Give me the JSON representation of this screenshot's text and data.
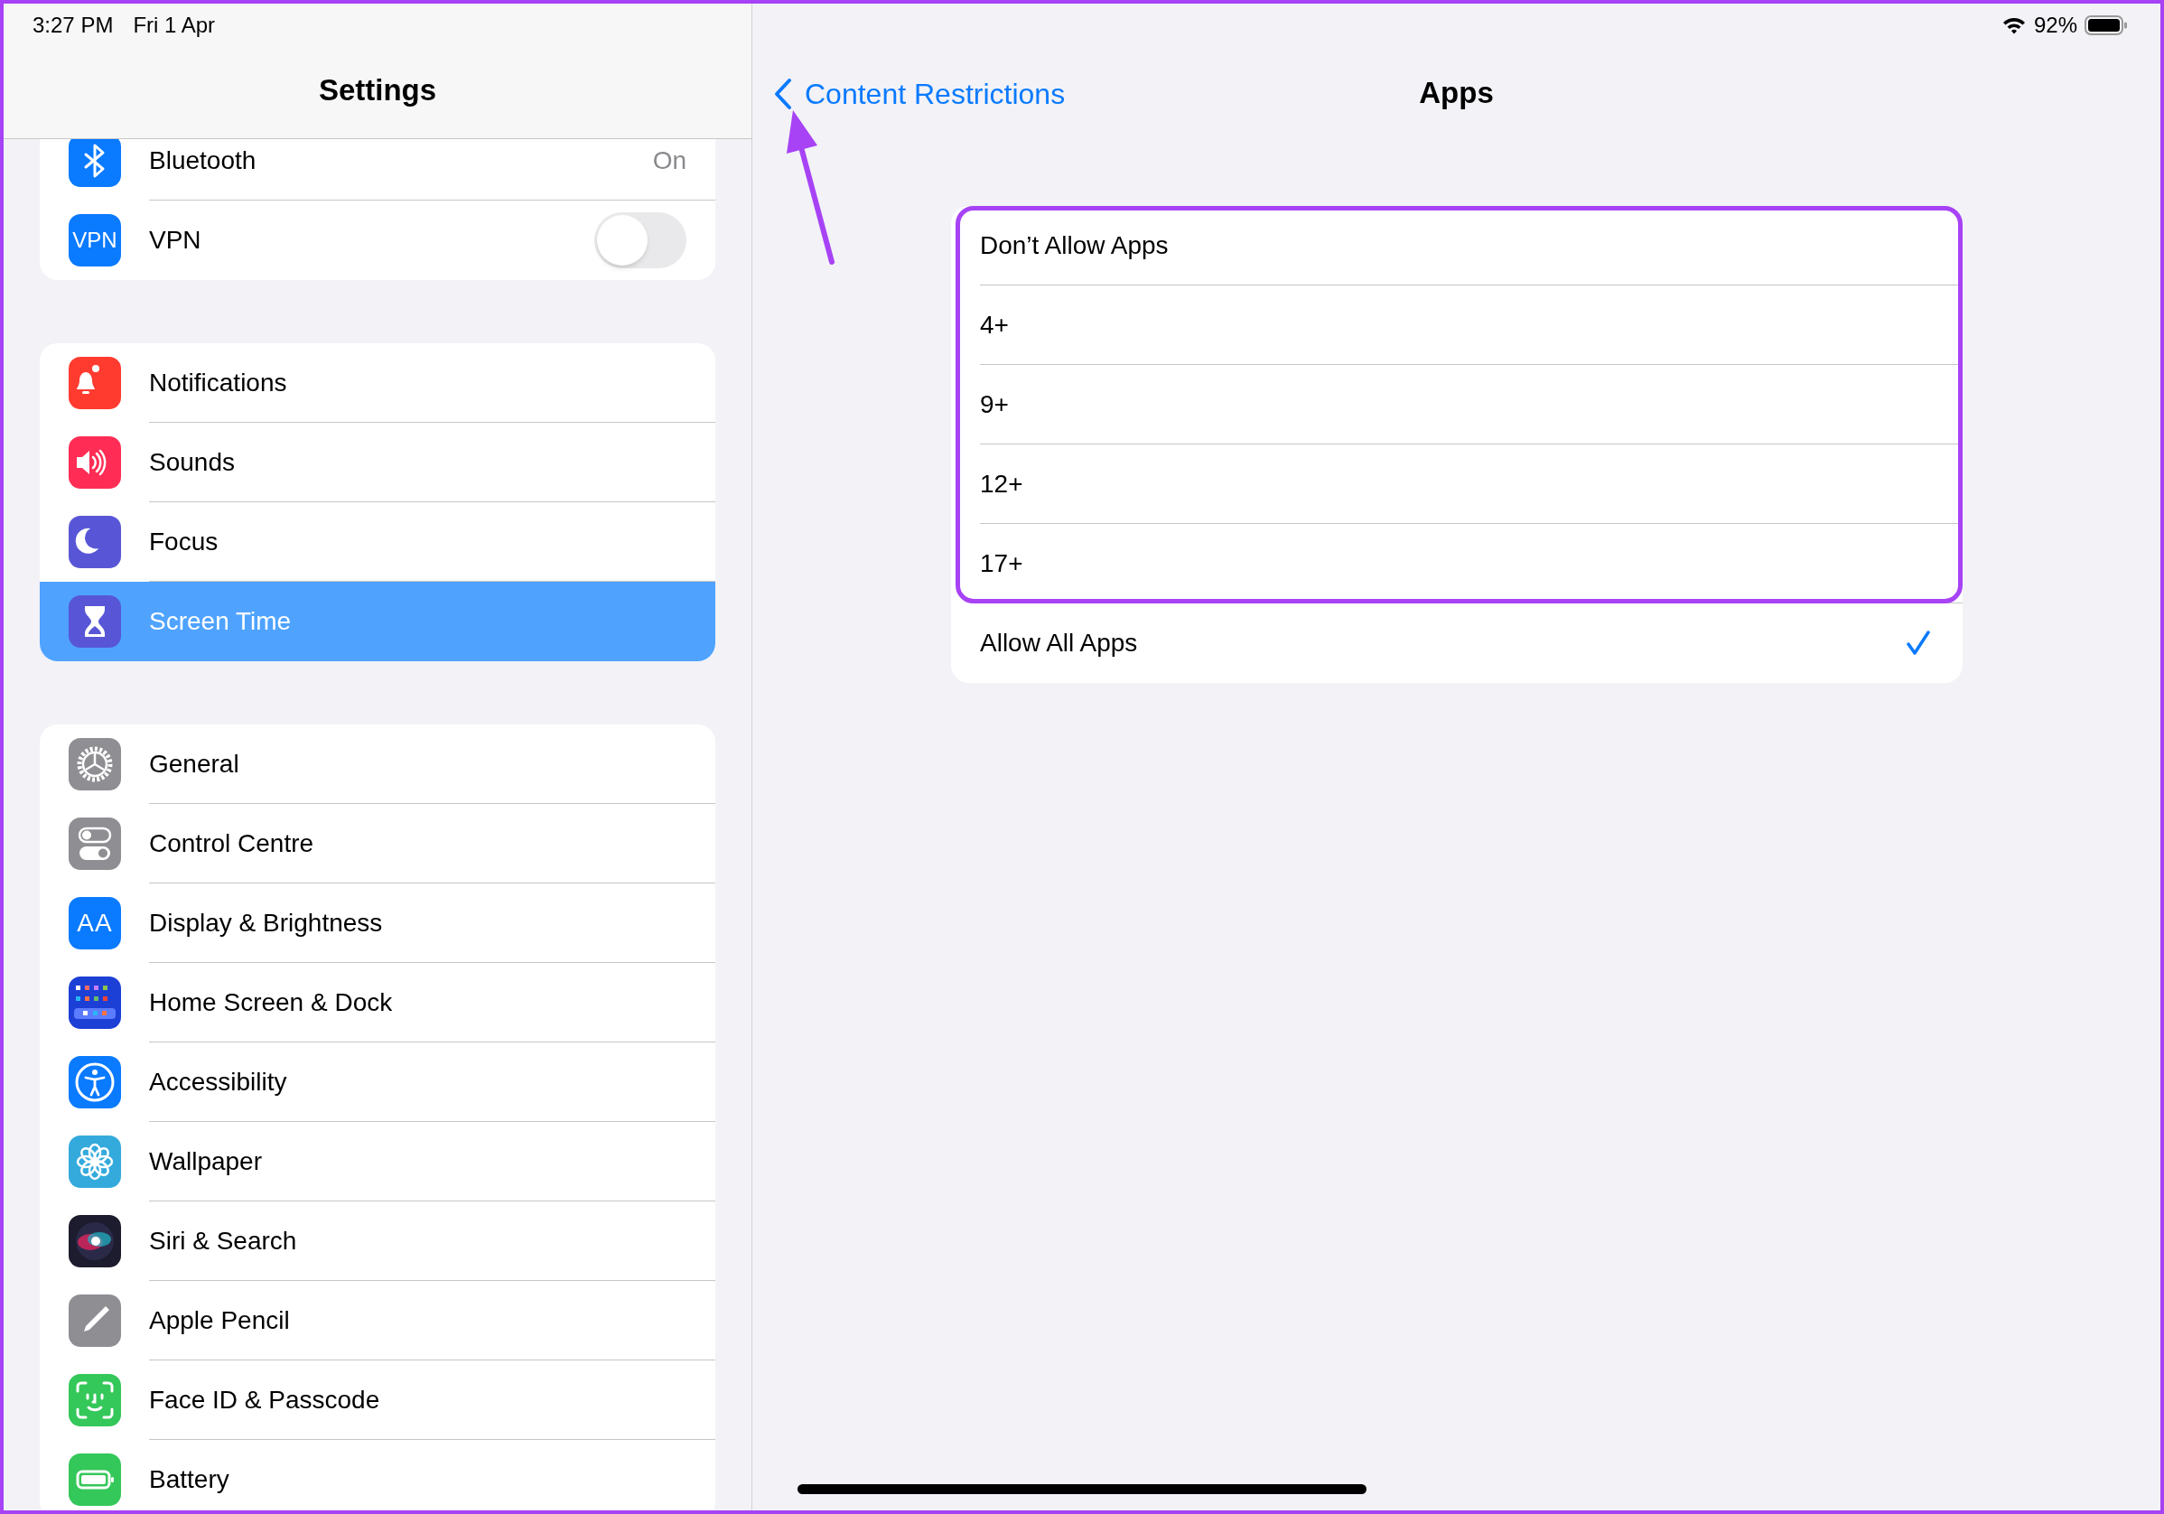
{
  "status_bar": {
    "time": "3:27 PM",
    "date": "Fri 1 Apr",
    "battery_percent": "92%"
  },
  "sidebar": {
    "title": "Settings",
    "groups": [
      {
        "items": [
          {
            "label": "Bluetooth",
            "kind": "value",
            "value": "On",
            "selected": false
          },
          {
            "label": "VPN",
            "kind": "toggle",
            "icon_text": "VPN",
            "on": false,
            "selected": false
          }
        ]
      },
      {
        "items": [
          {
            "label": "Notifications",
            "kind": "link",
            "selected": false
          },
          {
            "label": "Sounds",
            "kind": "link",
            "selected": false
          },
          {
            "label": "Focus",
            "kind": "link",
            "selected": false
          },
          {
            "label": "Screen Time",
            "kind": "link",
            "selected": true
          }
        ]
      },
      {
        "items": [
          {
            "label": "General",
            "kind": "link",
            "selected": false
          },
          {
            "label": "Control Centre",
            "kind": "link",
            "selected": false
          },
          {
            "label": "Display & Brightness",
            "kind": "link",
            "icon_text": "AA",
            "selected": false
          },
          {
            "label": "Home Screen & Dock",
            "kind": "link",
            "selected": false
          },
          {
            "label": "Accessibility",
            "kind": "link",
            "selected": false
          },
          {
            "label": "Wallpaper",
            "kind": "link",
            "selected": false
          },
          {
            "label": "Siri & Search",
            "kind": "link",
            "selected": false
          },
          {
            "label": "Apple Pencil",
            "kind": "link",
            "selected": false
          },
          {
            "label": "Face ID & Passcode",
            "kind": "link",
            "selected": false
          },
          {
            "label": "Battery",
            "kind": "link",
            "selected": false
          }
        ]
      }
    ]
  },
  "detail": {
    "back_label": "Content Restrictions",
    "title": "Apps",
    "options": [
      {
        "label": "Don’t Allow Apps",
        "selected": false
      },
      {
        "label": "4+",
        "selected": false
      },
      {
        "label": "9+",
        "selected": false
      },
      {
        "label": "12+",
        "selected": false
      },
      {
        "label": "17+",
        "selected": false
      },
      {
        "label": "Allow All Apps",
        "selected": true
      }
    ]
  },
  "annotations": {
    "highlight_frame": true,
    "pointer_arrow": true
  }
}
